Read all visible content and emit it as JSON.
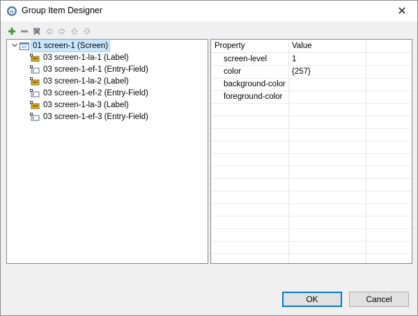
{
  "window": {
    "title": "Group Item Designer",
    "close_glyph": "✕"
  },
  "toolbar": {
    "items": [
      {
        "name": "add-icon"
      },
      {
        "name": "remove-icon"
      },
      {
        "name": "scissors-icon"
      },
      {
        "name": "arrow-left-icon"
      },
      {
        "name": "arrow-right-icon"
      },
      {
        "name": "arrow-up-icon"
      },
      {
        "name": "arrow-down-icon"
      }
    ]
  },
  "tree": {
    "root": {
      "label": "01 screen-1 (Screen)"
    },
    "children": [
      {
        "label": "03 screen-1-la-1 (Label)",
        "kind": "label"
      },
      {
        "label": "03 screen-1-ef-1 (Entry-Field)",
        "kind": "entry"
      },
      {
        "label": "03 screen-1-la-2 (Label)",
        "kind": "label"
      },
      {
        "label": "03 screen-1-ef-2 (Entry-Field)",
        "kind": "entry"
      },
      {
        "label": "03 screen-1-la-3 (Label)",
        "kind": "label"
      },
      {
        "label": "03 screen-1-ef-3 (Entry-Field)",
        "kind": "entry"
      }
    ]
  },
  "properties": {
    "headers": {
      "property": "Property",
      "value": "Value"
    },
    "rows": [
      {
        "name": "screen-level",
        "value": "1"
      },
      {
        "name": "color",
        "value": "{257}"
      },
      {
        "name": "background-color",
        "value": ""
      },
      {
        "name": "foreground-color",
        "value": ""
      }
    ]
  },
  "buttons": {
    "ok": "OK",
    "cancel": "Cancel"
  },
  "colors": {
    "selection": "#cce8ff",
    "primary_border": "#0078d7"
  }
}
